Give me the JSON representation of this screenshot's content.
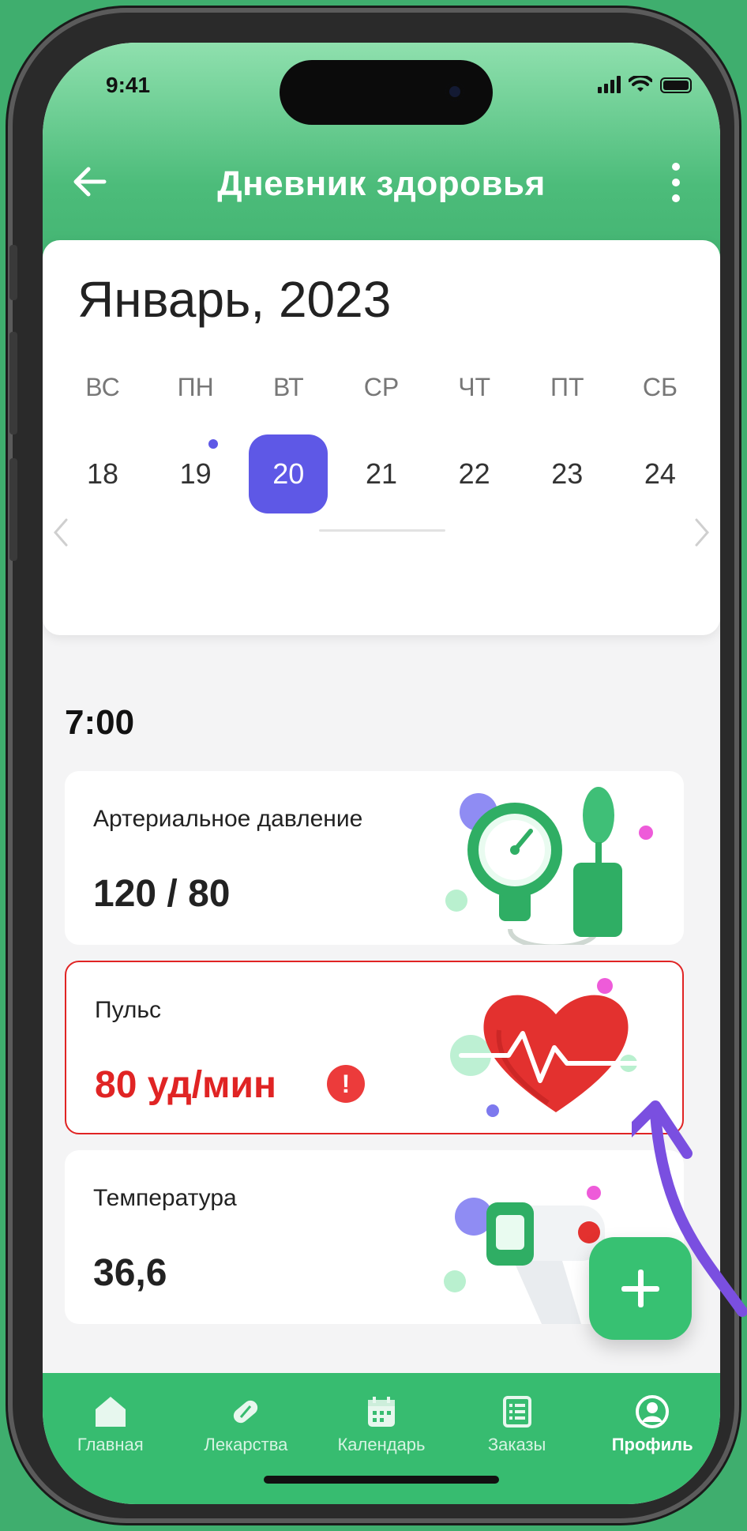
{
  "status_bar": {
    "time": "9:41"
  },
  "app_bar": {
    "title": "Дневник здоровья"
  },
  "calendar": {
    "month": "Январь, 2023",
    "weekdays": [
      "ВС",
      "ПН",
      "ВТ",
      "СР",
      "ЧТ",
      "ПТ",
      "СБ"
    ],
    "days": [
      "18",
      "19",
      "20",
      "21",
      "22",
      "23",
      "24"
    ],
    "selected_day": "20"
  },
  "schedule": {
    "time": "7:00",
    "cards": [
      {
        "label": "Артериальное давление",
        "value": "120 / 80",
        "icon": "tonometer-icon"
      },
      {
        "label": "Пульс",
        "value": "80 уд/мин",
        "icon": "heart-pulse-icon",
        "alert": true
      },
      {
        "label": "Температура",
        "value": "36,6",
        "icon": "thermometer-icon"
      }
    ]
  },
  "tab_bar": {
    "items": [
      {
        "label": "Главная",
        "icon": "home-icon"
      },
      {
        "label": "Лекарства",
        "icon": "pill-icon"
      },
      {
        "label": "Календарь",
        "icon": "calendar-icon"
      },
      {
        "label": "Заказы",
        "icon": "orders-icon"
      },
      {
        "label": "Профиль",
        "icon": "profile-icon",
        "active": true
      }
    ]
  },
  "colors": {
    "accent_green": "#37bc70",
    "selected_day": "#5e58e6",
    "alert_red": "#e02424",
    "annotation_arrow": "#7a4fe0"
  }
}
